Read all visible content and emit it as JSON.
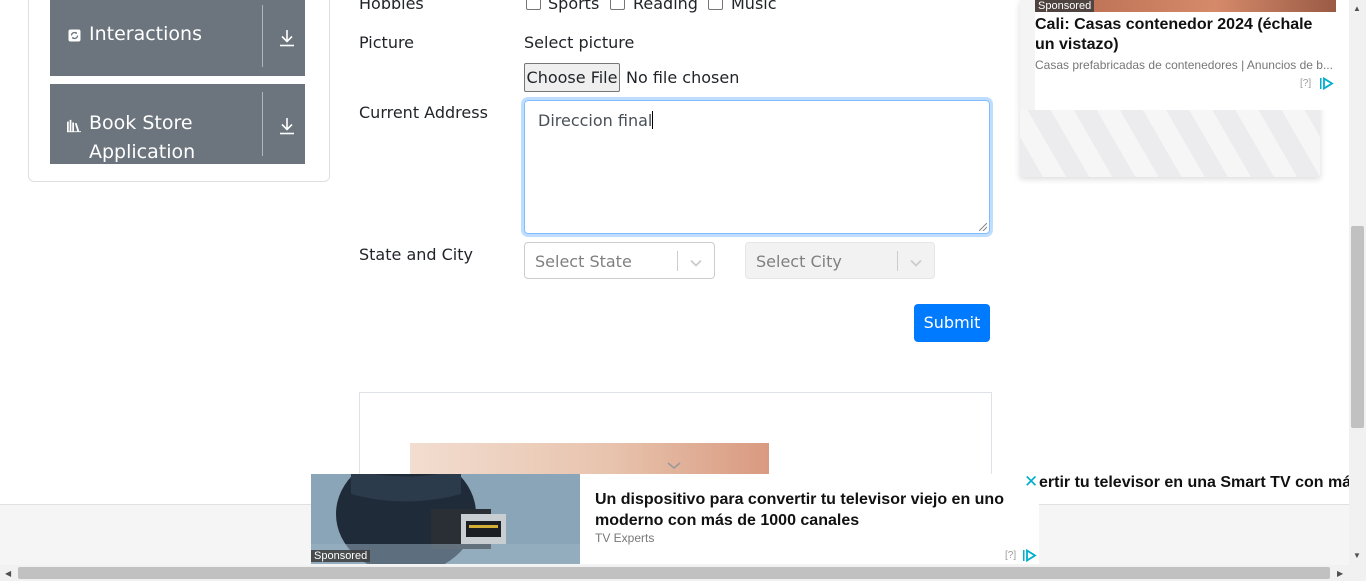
{
  "sidebar": {
    "groups": [
      {
        "label": "Interactions",
        "icon": "refresh-icon"
      },
      {
        "label": "Book Store Application",
        "icon": "books-icon"
      }
    ]
  },
  "form": {
    "hobbies": {
      "label": "Hobbies",
      "options": [
        "Sports",
        "Reading",
        "Music"
      ]
    },
    "picture": {
      "label": "Picture",
      "hint": "Select picture",
      "button": "Choose File",
      "status": "No file chosen"
    },
    "address": {
      "label": "Current Address",
      "value": "Direccion final"
    },
    "state_city": {
      "label": "State and City",
      "state_placeholder": "Select State",
      "city_placeholder": "Select City"
    },
    "submit": "Submit"
  },
  "ads": {
    "side": {
      "sponsored": "Sponsored",
      "title": "Cali: Casas contenedor 2024 (échale un vistazo)",
      "source": "Casas prefabricadas de contenedores | Anuncios de b...",
      "help": "[?]"
    },
    "bottom": {
      "sponsored": "Sponsored",
      "title": "Un dispositivo para convertir tu televisor viejo en uno moderno con más de 1000 canales",
      "source": "TV Experts",
      "help": "[?]",
      "ticker": "ertir tu televisor en una Smart TV con más"
    }
  },
  "colors": {
    "primary": "#007bff",
    "menu_bg": "#6c757d",
    "focus_border": "#80bdff",
    "adchoice": "#00aecd"
  }
}
